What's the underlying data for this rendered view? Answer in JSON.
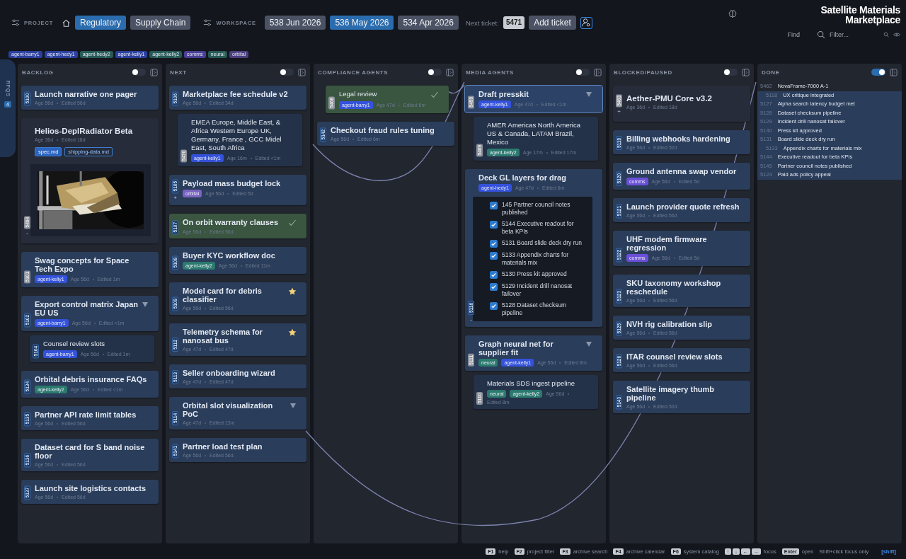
{
  "header": {
    "project_label": "PROJECT",
    "projects": [
      {
        "label": "Regulatory",
        "selected": true
      },
      {
        "label": "Supply Chain",
        "selected": false
      }
    ],
    "workspace_label": "WORKSPACE",
    "workspaces": [
      {
        "label": "538 Jun 2026",
        "selected": false
      },
      {
        "label": "536 May 2026",
        "selected": true
      },
      {
        "label": "534 Apr 2026",
        "selected": false
      }
    ],
    "next_ticket_label": "Next ticket:",
    "next_ticket": "5471",
    "add_ticket": "Add ticket",
    "title": "Satellite Materials Marketplace",
    "find_label": "Find",
    "filter_placeholder": "Filter..."
  },
  "tags": [
    {
      "label": "agent-barry1",
      "color": "#2b3f9e"
    },
    {
      "label": "agent-hedy1",
      "color": "#2b3f9e"
    },
    {
      "label": "agent-hedy2",
      "color": "#275a56"
    },
    {
      "label": "agent-kelly1",
      "color": "#2b3f9e"
    },
    {
      "label": "agent-kelly2",
      "color": "#275a56"
    },
    {
      "label": "comms",
      "color": "#4b3f94"
    },
    {
      "label": "neural",
      "color": "#275a56"
    },
    {
      "label": "orbital",
      "color": "#4b3f80"
    }
  ],
  "side_tab": {
    "label": "RFQS",
    "count": "4"
  },
  "columns": [
    {
      "title": "BACKLOG",
      "on": false,
      "kind": "board",
      "cards": [
        {
          "id": "5100",
          "muted": false,
          "kind": "ticket",
          "title": "Launch narrative one pager",
          "age": "Age 56d",
          "edited": "Edited 56d",
          "selected": false,
          "done": false,
          "starred": false,
          "caret": false
        },
        {
          "id": "5464",
          "muted": true,
          "kind": "external",
          "title": "Helios-DeplRadiator Beta",
          "sign": "-",
          "age": "Age 36d",
          "edited": "Edited 18d",
          "files": [
            {
              "label": "spec.md",
              "selected": true
            },
            {
              "label": "shipping-data.md",
              "selected": false
            }
          ],
          "media": {
            "kind": "picture"
          },
          "selected": false,
          "done": false,
          "starred": false,
          "caret": false
        },
        {
          "id": "5101",
          "muted": true,
          "kind": "ticket",
          "title": "Swag concepts for Space Tech Expo",
          "tags": [
            {
              "label": "agent-kelly1",
              "color": "#3452db"
            }
          ],
          "age": "Age 56d",
          "edited": "Edited 1m",
          "selected": false,
          "done": false,
          "starred": false,
          "caret": false
        },
        {
          "id": "5102",
          "muted": false,
          "kind": "ticket",
          "title": "Export control matrix Japan EU US",
          "tags": [
            {
              "label": "agent-barry1",
              "color": "#3452db"
            }
          ],
          "age": "Age 56d",
          "edited": "Edited <1m",
          "selected": false,
          "done": false,
          "starred": false,
          "caret": true,
          "children": [
            {
              "id": "5104",
              "muted": false,
              "kind": "linked",
              "title": "Counsel review slots",
              "tags": [
                {
                  "label": "agent-barry1",
                  "color": "#3452db"
                }
              ],
              "age": "Age 56d",
              "edited": "Edited 1m",
              "selected": false,
              "done": false,
              "starred": false,
              "caret": false
            }
          ]
        },
        {
          "id": "5134",
          "muted": false,
          "kind": "ticket",
          "title": "Orbital debris insurance FAQs",
          "tags": [
            {
              "label": "agent-kelly2",
              "color": "#2b7a6d"
            }
          ],
          "age": "Age 56d",
          "edited": "Edited <1m",
          "selected": false,
          "done": false,
          "starred": false,
          "caret": false
        },
        {
          "id": "5135",
          "muted": false,
          "kind": "ticket",
          "title": "Partner API rate limit tables",
          "age": "Age 56d",
          "edited": "Edited 56d",
          "selected": false,
          "done": false,
          "starred": false,
          "caret": false
        },
        {
          "id": "5136",
          "muted": false,
          "kind": "ticket",
          "title": "Dataset card for S band noise floor",
          "age": "Age 56d",
          "edited": "Edited 56d",
          "selected": false,
          "done": false,
          "starred": false,
          "caret": false
        },
        {
          "id": "5137",
          "muted": false,
          "kind": "ticket",
          "title": "Launch site logistics contacts",
          "age": "Age 56d",
          "edited": "Edited 56d",
          "selected": false,
          "done": false,
          "starred": false,
          "caret": false
        }
      ]
    },
    {
      "title": "NEXT",
      "on": false,
      "kind": "board",
      "cards": [
        {
          "id": "5106",
          "muted": false,
          "kind": "ticket",
          "title": "Marketplace fee schedule v2",
          "age": "Age 56d",
          "edited": "Edited 34d",
          "selected": false,
          "done": false,
          "starred": false,
          "caret": false,
          "children": [
            {
              "id": "5470",
              "muted": true,
              "kind": "linked",
              "title": "EMEA Europe, Middle East, & Africa Western Europe UK, Germany, France , GCC Midel East, South Africa",
              "tags": [
                {
                  "label": "agent-kelly1",
                  "color": "#3452db"
                }
              ],
              "age": "Age 16m",
              "edited": "Edited <1m",
              "selected": false,
              "done": false,
              "starred": false,
              "caret": false
            }
          ]
        },
        {
          "id": "5105",
          "muted": false,
          "kind": "ticket",
          "title": "Payload mass budget lock",
          "sign": "+",
          "tags": [
            {
              "label": "orbital",
              "color": "#7a63c0"
            }
          ],
          "age": "Age 56d",
          "edited": "Edited 5d",
          "selected": false,
          "done": false,
          "starred": false,
          "caret": false
        },
        {
          "id": "5107",
          "muted": false,
          "kind": "ticket",
          "title": "On orbit warranty clauses",
          "age": "Age 56d",
          "edited": "Edited 56d",
          "selected": false,
          "done": true,
          "starred": false,
          "caret": false
        },
        {
          "id": "5108",
          "muted": false,
          "kind": "ticket",
          "title": "Buyer KYC workflow doc",
          "tags": [
            {
              "label": "agent-kelly2",
              "color": "#2b7a6d"
            }
          ],
          "age": "Age 56d",
          "edited": "Edited 11m",
          "selected": false,
          "done": false,
          "starred": false,
          "caret": false
        },
        {
          "id": "5109",
          "muted": false,
          "kind": "ticket",
          "title": "Model card for debris classifier",
          "age": "Age 56d",
          "edited": "Edited 56d",
          "selected": false,
          "done": false,
          "starred": true,
          "caret": false
        },
        {
          "id": "5112",
          "muted": false,
          "kind": "ticket",
          "title": "Telemetry schema for nanosat bus",
          "age": "Age 47d",
          "edited": "Edited 47d",
          "selected": false,
          "done": false,
          "starred": true,
          "caret": false
        },
        {
          "id": "5113",
          "muted": false,
          "kind": "ticket",
          "title": "Seller onboarding wizard",
          "age": "Age 47d",
          "edited": "Edited 47d",
          "selected": false,
          "done": false,
          "starred": false,
          "caret": false
        },
        {
          "id": "5114",
          "muted": false,
          "kind": "ticket",
          "title": "Orbital slot visualization PoC",
          "age": "Age 47d",
          "edited": "Edited 13m",
          "selected": false,
          "done": false,
          "starred": false,
          "caret": true
        },
        {
          "id": "5141",
          "muted": false,
          "kind": "ticket",
          "title": "Partner load test plan",
          "age": "Age 56d",
          "edited": "Edited 56d",
          "selected": false,
          "done": false,
          "starred": false,
          "caret": false
        }
      ]
    },
    {
      "title": "COMPLIANCE AGENTS",
      "on": false,
      "kind": "board",
      "cards": [
        {
          "id": "5468",
          "muted": true,
          "kind": "linked",
          "title": "Legal review",
          "tags": [
            {
              "label": "agent-barry1",
              "color": "#3452db"
            }
          ],
          "age": "Age 47d",
          "edited": "Edited 6m",
          "selected": false,
          "done": true,
          "starred": false,
          "caret": false
        },
        {
          "id": "5142",
          "muted": false,
          "kind": "ticket",
          "title": "Checkout fraud rules tuning",
          "age": "Age 56d",
          "edited": "Edited 6m",
          "selected": false,
          "done": false,
          "starred": false,
          "caret": false
        }
      ]
    },
    {
      "title": "MEDIA AGENTS",
      "on": false,
      "kind": "board",
      "cards": [
        {
          "id": "5459",
          "muted": true,
          "kind": "ticket",
          "title": "Draft presskit",
          "tags": [
            {
              "label": "agent-kelly1",
              "color": "#3452db"
            }
          ],
          "age": "Age 47d",
          "edited": "Edited <1m",
          "selected": true,
          "done": false,
          "starred": false,
          "caret": true,
          "children": [
            {
              "id": "5469",
              "muted": true,
              "kind": "linked",
              "title": "AMER Americas North America US & Canada, LATAM Brazil, Mexico",
              "tags": [
                {
                  "label": "agent-kelly2",
                  "color": "#2b7a6d"
                }
              ],
              "age": "Age 17m",
              "edited": "Edited 17m",
              "selected": false,
              "done": false,
              "starred": false,
              "caret": false
            }
          ]
        },
        {
          "id": "5116",
          "muted": false,
          "kind": "ticket",
          "title": "Deck GL layers for drag",
          "sign": "-",
          "tags": [
            {
              "label": "agent-hedy1",
              "color": "#3452db"
            }
          ],
          "age": "Age 47d",
          "edited": "Edited 6m",
          "selected": false,
          "done": false,
          "starred": false,
          "caret": false,
          "checklist": [
            {
              "label": "145 Partner council notes published",
              "checked": true
            },
            {
              "label": "5144 Executive readout for beta KPIs",
              "checked": true
            },
            {
              "label": "5131 Board slide deck dry run",
              "checked": true
            },
            {
              "label": "5133 Appendix charts for materials mix",
              "checked": true
            },
            {
              "label": "5130 Press kit approved",
              "checked": true
            },
            {
              "label": "5129 Incident drill nanosat failover",
              "checked": true
            },
            {
              "label": "5128 Dataset checksum pipeline",
              "checked": true
            }
          ]
        },
        {
          "id": "5111",
          "muted": true,
          "kind": "ticket",
          "title": "Graph neural net for supplier fit",
          "tags": [
            {
              "label": "neural",
              "color": "#2b7a6d"
            },
            {
              "label": "agent-kelly1",
              "color": "#3452db"
            }
          ],
          "age": "Age 56d",
          "edited": "Edited 8m",
          "selected": false,
          "done": false,
          "starred": false,
          "caret": true,
          "children": [
            {
              "id": "5110",
              "muted": true,
              "kind": "linked",
              "title": "Materials SDS ingest pipeline",
              "tags": [
                {
                  "label": "neural",
                  "color": "#2b7a6d"
                },
                {
                  "label": "agent-kelly2",
                  "color": "#2b7a6d"
                }
              ],
              "age": "Age 56d",
              "edited": "Edited 8m",
              "selected": false,
              "done": false,
              "starred": false,
              "caret": false
            }
          ]
        }
      ]
    },
    {
      "title": "BLOCKED/PAUSED",
      "on": false,
      "kind": "board",
      "cards": [
        {
          "id": "5463",
          "muted": true,
          "kind": "external",
          "title": "Aether-PMU Core v3.2",
          "sign": "+",
          "age": "Age 36d",
          "edited": "Edited 18d",
          "selected": false,
          "done": false,
          "starred": false,
          "caret": false
        },
        {
          "id": "5119",
          "muted": false,
          "kind": "ticket",
          "title": "Billing webhooks hardening",
          "age": "Age 56d",
          "edited": "Edited 52d",
          "selected": false,
          "done": false,
          "starred": false,
          "caret": false
        },
        {
          "id": "5120",
          "muted": false,
          "kind": "ticket",
          "title": "Ground antenna swap vendor",
          "tags": [
            {
              "label": "comms",
              "color": "#6b4fd8"
            }
          ],
          "age": "Age 56d",
          "edited": "Edited 5d",
          "selected": false,
          "done": false,
          "starred": false,
          "caret": false
        },
        {
          "id": "5121",
          "muted": false,
          "kind": "ticket",
          "title": "Launch provider quote refresh",
          "age": "Age 56d",
          "edited": "Edited 56d",
          "selected": false,
          "done": false,
          "starred": false,
          "caret": false
        },
        {
          "id": "5122",
          "muted": false,
          "kind": "ticket",
          "title": "UHF modem firmware regression",
          "tags": [
            {
              "label": "comms",
              "color": "#6b4fd8"
            }
          ],
          "age": "Age 56d",
          "edited": "Edited 5d",
          "selected": false,
          "done": false,
          "starred": false,
          "caret": false
        },
        {
          "id": "5123",
          "muted": false,
          "kind": "ticket",
          "title": "SKU taxonomy workshop reschedule",
          "age": "Age 56d",
          "edited": "Edited 56d",
          "selected": false,
          "done": false,
          "starred": false,
          "caret": false
        },
        {
          "id": "5125",
          "muted": false,
          "kind": "ticket",
          "title": "NVH rig calibration slip",
          "age": "Age 56d",
          "edited": "Edited 56d",
          "selected": false,
          "done": false,
          "starred": false,
          "caret": false
        },
        {
          "id": "5126",
          "muted": false,
          "kind": "ticket",
          "title": "ITAR counsel review slots",
          "age": "Age 56d",
          "edited": "Edited 56d",
          "selected": false,
          "done": false,
          "starred": false,
          "caret": false
        },
        {
          "id": "5143",
          "muted": false,
          "kind": "ticket",
          "title": "Satellite imagery thumb pipeline",
          "age": "Age 56d",
          "edited": "Edited 52d",
          "selected": false,
          "done": false,
          "starred": false,
          "caret": false
        }
      ]
    },
    {
      "title": "DONE",
      "on": true,
      "kind": "list",
      "items": [
        {
          "id": "5462",
          "title": "NovaFrame-7000 A-1",
          "highlighted": false,
          "children": [
            {
              "id": "5118",
              "title": "UX critique integrated",
              "highlighted": true
            }
          ]
        },
        {
          "id": "5127",
          "title": "Alpha search latency budget met",
          "highlighted": true
        },
        {
          "id": "5128",
          "title": "Dataset checksum pipeline",
          "highlighted": true
        },
        {
          "id": "5129",
          "title": "Incident drill nanosat failover",
          "highlighted": true
        },
        {
          "id": "5130",
          "title": "Press kit approved",
          "highlighted": true
        },
        {
          "id": "5131",
          "title": "Board slide deck dry run",
          "highlighted": true,
          "children": [
            {
              "id": "5133",
              "title": "Appendix charts for materials mix",
              "highlighted": true
            }
          ]
        },
        {
          "id": "5144",
          "title": "Executive readout for beta KPIs",
          "highlighted": true
        },
        {
          "id": "5145",
          "title": "Partner council notes published",
          "highlighted": true
        },
        {
          "id": "5124",
          "title": "Paid ads policy appeal",
          "highlighted": true
        }
      ]
    }
  ],
  "footer": {
    "shortcuts": [
      {
        "keys": [
          "F1"
        ],
        "label": "help"
      },
      {
        "keys": [
          "F2"
        ],
        "label": "project filter"
      },
      {
        "keys": [
          "F3"
        ],
        "label": "archive search"
      },
      {
        "keys": [
          "F4"
        ],
        "label": "archive calendar"
      },
      {
        "keys": [
          "F6"
        ],
        "label": "system catalog"
      },
      {
        "keys": [
          "↑",
          "↓",
          "←",
          "→"
        ],
        "label": "focus"
      },
      {
        "keys": [
          "Enter"
        ],
        "label": "open"
      }
    ],
    "note": "Shift+click focus only",
    "modifier": "[shift]"
  }
}
